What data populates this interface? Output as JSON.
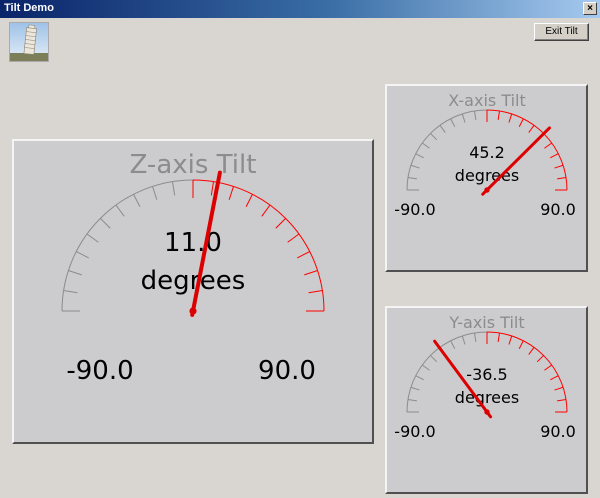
{
  "window": {
    "title": "Tilt Demo",
    "close_glyph": "×"
  },
  "toolbar": {
    "exit_label": "Exit Tilt"
  },
  "colors": {
    "needle": "#dd0000",
    "tick_negative": "#8c8c8c",
    "tick_positive": "#ff0000",
    "title_text": "#8c8c8c"
  },
  "gauges": {
    "z": {
      "title": "Z-axis Tilt",
      "value": 11.0,
      "value_text": "11.0",
      "unit": "degrees",
      "min": -90,
      "max": 90,
      "min_label": "-90.0",
      "max_label": "90.0"
    },
    "x": {
      "title": "X-axis Tilt",
      "value": 45.2,
      "value_text": "45.2",
      "unit": "degrees",
      "min": -90,
      "max": 90,
      "min_label": "-90.0",
      "max_label": "90.0"
    },
    "y": {
      "title": "Y-axis Tilt",
      "value": -36.5,
      "value_text": "-36.5",
      "unit": "degrees",
      "min": -90,
      "max": 90,
      "min_label": "-90.0",
      "max_label": "90.0"
    }
  }
}
